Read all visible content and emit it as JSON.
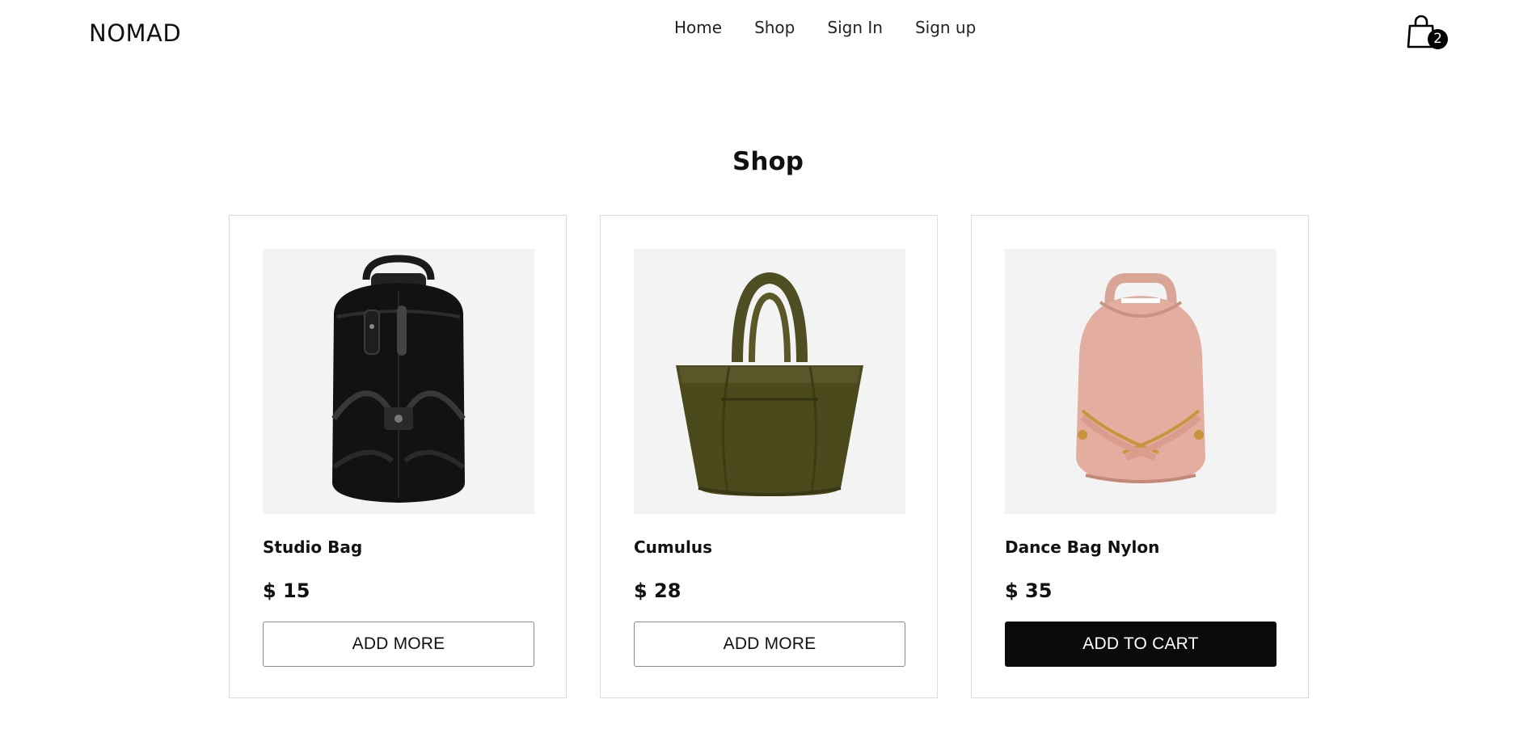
{
  "header": {
    "brand": "NOMAD",
    "nav": [
      {
        "label": "Home"
      },
      {
        "label": "Shop"
      },
      {
        "label": "Sign In"
      },
      {
        "label": "Sign up"
      }
    ],
    "cart": {
      "icon": "shopping-bag-icon",
      "count": "2"
    }
  },
  "main": {
    "title": "Shop",
    "products": [
      {
        "name": "Studio Bag",
        "price": "$ 15",
        "button": "ADD MORE",
        "image": "black-backpack",
        "button_style": "outline"
      },
      {
        "name": "Cumulus",
        "price": "$ 28",
        "button": "ADD MORE",
        "image": "olive-tote-bag",
        "button_style": "outline"
      },
      {
        "name": "Dance Bag Nylon",
        "price": "$ 35",
        "button": "ADD TO CART",
        "image": "pink-backpack",
        "button_style": "solid"
      }
    ]
  },
  "colors": {
    "background": "#ffffff",
    "text": "#111111",
    "image_bg": "#f3f3f3",
    "card_border": "#dcdcdc",
    "button_solid": "#0b0b0b",
    "badge": "#000000"
  }
}
